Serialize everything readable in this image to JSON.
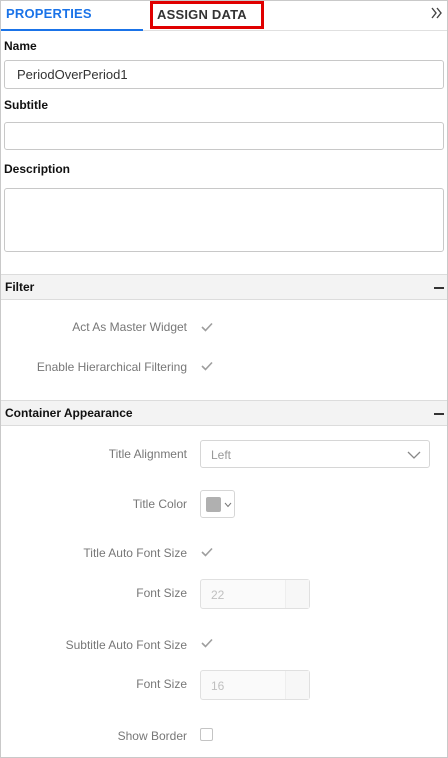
{
  "tabs": [
    {
      "label": "PROPERTIES"
    },
    {
      "label": "ASSIGN DATA"
    }
  ],
  "fields": {
    "name_label": "Name",
    "name_value": "PeriodOverPeriod1",
    "subtitle_label": "Subtitle",
    "subtitle_value": "",
    "description_label": "Description",
    "description_value": ""
  },
  "filter": {
    "title": "Filter",
    "act_as_master_widget": {
      "label": "Act As Master Widget",
      "checked": true
    },
    "enable_hierarchical_filtering": {
      "label": "Enable Hierarchical Filtering",
      "checked": true
    }
  },
  "container_appearance": {
    "title": "Container Appearance",
    "title_alignment": {
      "label": "Title Alignment",
      "value": "Left"
    },
    "title_color": {
      "label": "Title Color",
      "color": "#b0b0b0"
    },
    "title_auto_font_size": {
      "label": "Title Auto Font Size",
      "checked": true
    },
    "title_font_size": {
      "label": "Font Size",
      "value": "22"
    },
    "subtitle_auto_font_size": {
      "label": "Subtitle Auto Font Size",
      "checked": true
    },
    "subtitle_font_size": {
      "label": "Font Size",
      "value": "16"
    },
    "show_border": {
      "label": "Show Border",
      "checked": false
    }
  },
  "icons": {
    "collapse": "double-chevron-right-icon",
    "section_toggle": "minus-icon",
    "dropdown": "chevron-down-icon",
    "check": "check-icon"
  },
  "colors": {
    "accent": "#1a73e8",
    "highlight_box": "#e00000"
  }
}
